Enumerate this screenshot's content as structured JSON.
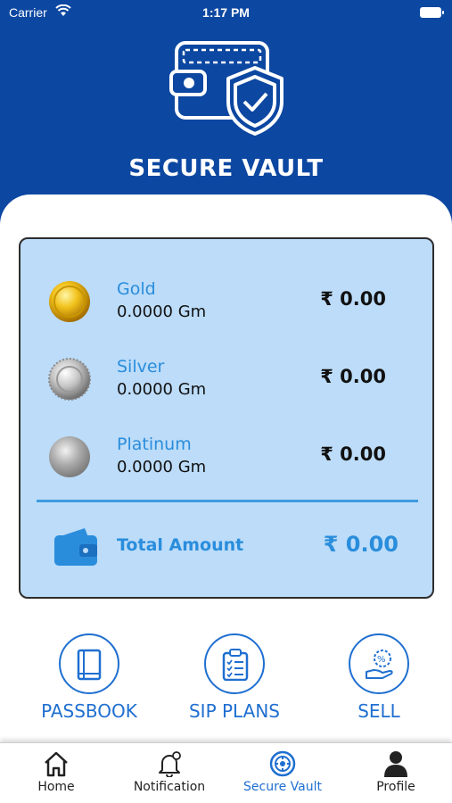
{
  "status_bar": {
    "carrier": "Carrier",
    "time": "1:17 PM"
  },
  "header": {
    "title": "SECURE VAULT"
  },
  "holdings": [
    {
      "metal": "Gold",
      "weight": "0.0000 Gm",
      "value": "₹ 0.00",
      "icon": "gold-coin-icon"
    },
    {
      "metal": "Silver",
      "weight": "0.0000 Gm",
      "value": "₹ 0.00",
      "icon": "silver-coin-icon"
    },
    {
      "metal": "Platinum",
      "weight": "0.0000 Gm",
      "value": "₹ 0.00",
      "icon": "platinum-coin-icon"
    }
  ],
  "total": {
    "label": "Total Amount",
    "value": "₹ 0.00",
    "icon": "wallet-icon"
  },
  "actions": [
    {
      "label": "PASSBOOK",
      "icon": "passbook-icon"
    },
    {
      "label": "SIP PLANS",
      "icon": "clipboard-icon"
    },
    {
      "label": "SELL",
      "icon": "sell-hand-icon"
    }
  ],
  "tabs": [
    {
      "label": "Home",
      "icon": "home-icon"
    },
    {
      "label": "Notification",
      "icon": "bell-icon"
    },
    {
      "label": "Secure Vault",
      "icon": "vault-icon",
      "active": true
    },
    {
      "label": "Profile",
      "icon": "person-icon"
    }
  ],
  "colors": {
    "header": "#0c47a1",
    "card": "#bcdcf9",
    "accent": "#2a8ddc",
    "action": "#1f6fd0"
  }
}
